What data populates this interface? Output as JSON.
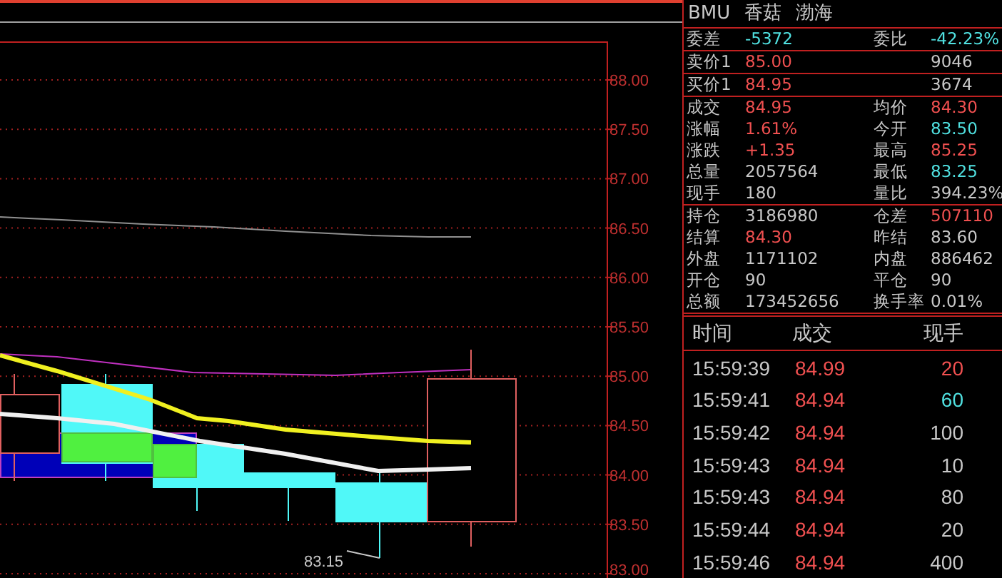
{
  "chart": {
    "price_labels": [
      "88.00",
      "87.50",
      "87.00",
      "86.50",
      "86.00",
      "85.50",
      "85.00",
      "84.50",
      "84.00",
      "83.50",
      "83.00"
    ],
    "low_label": "83.15"
  },
  "quote": {
    "code": "BMU",
    "name": "香菇",
    "exchange": "渤海",
    "sections": [
      {
        "rows": [
          {
            "left": {
              "label": "委差",
              "value": "-5372",
              "color": "#50e0e0"
            },
            "right": {
              "label": "委比",
              "value": "-42.23%",
              "color": "#50e0e0"
            }
          }
        ]
      },
      {
        "rows": [
          {
            "left": {
              "label": "卖价1",
              "value": "85.00",
              "color": "#f05050"
            },
            "right": {
              "value": "9046",
              "color": "#c8c8c8"
            }
          }
        ]
      },
      {
        "rows": [
          {
            "left": {
              "label": "买价1",
              "value": "84.95",
              "color": "#f05050"
            },
            "right": {
              "value": "3674",
              "color": "#c8c8c8"
            }
          }
        ]
      },
      {
        "rows": [
          {
            "left": {
              "label": "成交",
              "value": "84.95",
              "color": "#f05050"
            },
            "right": {
              "label": "均价",
              "value": "84.30",
              "color": "#f05050"
            }
          },
          {
            "left": {
              "label": "涨幅",
              "value": "1.61%",
              "color": "#f05050"
            },
            "right": {
              "label": "今开",
              "value": "83.50",
              "color": "#50e0e0"
            }
          },
          {
            "left": {
              "label": "涨跌",
              "value": "+1.35",
              "color": "#f05050"
            },
            "right": {
              "label": "最高",
              "value": "85.25",
              "color": "#f05050"
            }
          },
          {
            "left": {
              "label": "总量",
              "value": "2057564",
              "color": "#c8c8c8"
            },
            "right": {
              "label": "最低",
              "value": "83.25",
              "color": "#50e0e0"
            }
          },
          {
            "left": {
              "label": "现手",
              "value": "180",
              "color": "#c8c8c8"
            },
            "right": {
              "label": "量比",
              "value": "394.23%",
              "color": "#c8c8c8"
            }
          }
        ]
      },
      {
        "rows": [
          {
            "left": {
              "label": "持仓",
              "value": "3186980",
              "color": "#c8c8c8"
            },
            "right": {
              "label": "仓差",
              "value": "507110",
              "color": "#f05050"
            }
          },
          {
            "left": {
              "label": "结算",
              "value": "84.30",
              "color": "#f05050"
            },
            "right": {
              "label": "昨结",
              "value": "83.60",
              "color": "#c8c8c8"
            }
          },
          {
            "left": {
              "label": "外盘",
              "value": "1171102",
              "color": "#c8c8c8"
            },
            "right": {
              "label": "内盘",
              "value": "886462",
              "color": "#c8c8c8"
            }
          },
          {
            "left": {
              "label": "开仓",
              "value": "90",
              "color": "#c8c8c8"
            },
            "right": {
              "label": "平仓",
              "value": "90",
              "color": "#c8c8c8"
            }
          },
          {
            "left": {
              "label": "总额",
              "value": "173452656",
              "color": "#c8c8c8"
            },
            "right": {
              "label": "换手率",
              "value": "0.01%",
              "color": "#c8c8c8"
            }
          }
        ]
      }
    ]
  },
  "trades": {
    "columns": [
      "时间",
      "成交",
      "现手"
    ],
    "rows": [
      {
        "time": "15:59:39",
        "price": "84.99",
        "volume": "20",
        "color": "#f05050"
      },
      {
        "time": "15:59:41",
        "price": "84.94",
        "volume": "60",
        "color": "#50e0e0"
      },
      {
        "time": "15:59:42",
        "price": "84.94",
        "volume": "100",
        "color": "#c8c8c8"
      },
      {
        "time": "15:59:43",
        "price": "84.94",
        "volume": "10",
        "color": "#c8c8c8"
      },
      {
        "time": "15:59:43",
        "price": "84.94",
        "volume": "80",
        "color": "#c8c8c8"
      },
      {
        "time": "15:59:44",
        "price": "84.94",
        "volume": "20",
        "color": "#c8c8c8"
      },
      {
        "time": "15:59:46",
        "price": "84.94",
        "volume": "400",
        "color": "#c8c8c8"
      }
    ]
  }
}
